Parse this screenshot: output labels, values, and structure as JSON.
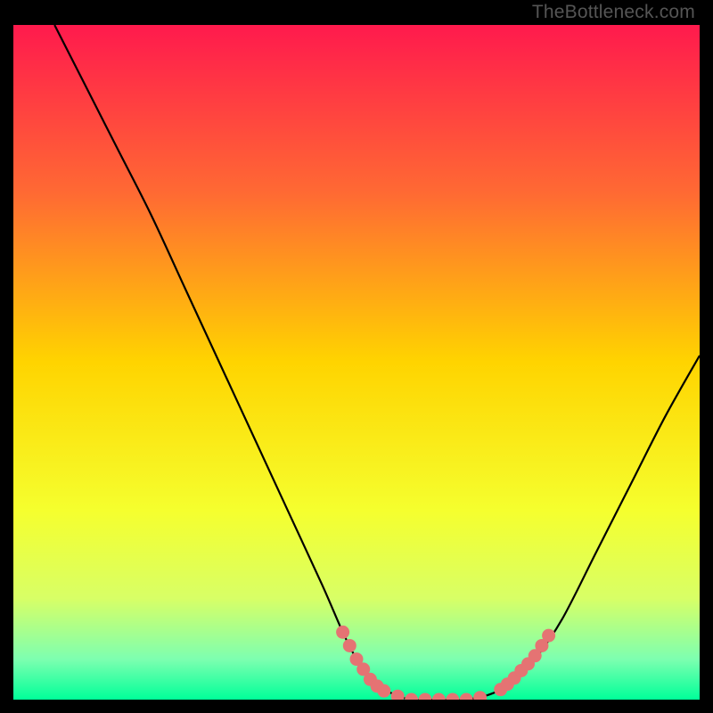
{
  "watermark": "TheBottleneck.com",
  "chart_data": {
    "type": "line",
    "title": "",
    "xlabel": "",
    "ylabel": "",
    "xlim": [
      0,
      100
    ],
    "ylim": [
      0,
      100
    ],
    "background_gradient": {
      "stops": [
        {
          "offset": 0.0,
          "color": "#ff1a4d"
        },
        {
          "offset": 0.25,
          "color": "#ff6a33"
        },
        {
          "offset": 0.5,
          "color": "#ffd400"
        },
        {
          "offset": 0.72,
          "color": "#f5ff2e"
        },
        {
          "offset": 0.85,
          "color": "#d8ff66"
        },
        {
          "offset": 0.94,
          "color": "#7dffb0"
        },
        {
          "offset": 1.0,
          "color": "#00ff99"
        }
      ]
    },
    "series": [
      {
        "name": "bottleneck-curve",
        "color": "#000000",
        "points": [
          {
            "x": 6,
            "y": 100
          },
          {
            "x": 10,
            "y": 92
          },
          {
            "x": 15,
            "y": 82
          },
          {
            "x": 20,
            "y": 72
          },
          {
            "x": 25,
            "y": 61
          },
          {
            "x": 30,
            "y": 50
          },
          {
            "x": 35,
            "y": 39
          },
          {
            "x": 40,
            "y": 28
          },
          {
            "x": 45,
            "y": 17
          },
          {
            "x": 48,
            "y": 10
          },
          {
            "x": 50,
            "y": 6
          },
          {
            "x": 52,
            "y": 3
          },
          {
            "x": 55,
            "y": 1
          },
          {
            "x": 58,
            "y": 0
          },
          {
            "x": 62,
            "y": 0
          },
          {
            "x": 66,
            "y": 0
          },
          {
            "x": 70,
            "y": 1
          },
          {
            "x": 73,
            "y": 3
          },
          {
            "x": 76,
            "y": 6
          },
          {
            "x": 80,
            "y": 12
          },
          {
            "x": 85,
            "y": 22
          },
          {
            "x": 90,
            "y": 32
          },
          {
            "x": 95,
            "y": 42
          },
          {
            "x": 100,
            "y": 51
          }
        ]
      }
    ],
    "dot_clusters": [
      {
        "name": "left-cluster",
        "color": "#e57373",
        "points": [
          {
            "x": 48,
            "y": 10
          },
          {
            "x": 49,
            "y": 8
          },
          {
            "x": 50,
            "y": 6
          },
          {
            "x": 51,
            "y": 4.5
          },
          {
            "x": 52,
            "y": 3
          },
          {
            "x": 53,
            "y": 2
          },
          {
            "x": 54,
            "y": 1.3
          }
        ]
      },
      {
        "name": "bottom-cluster",
        "color": "#e57373",
        "points": [
          {
            "x": 56,
            "y": 0.5
          },
          {
            "x": 58,
            "y": 0
          },
          {
            "x": 60,
            "y": 0
          },
          {
            "x": 62,
            "y": 0
          },
          {
            "x": 64,
            "y": 0
          },
          {
            "x": 66,
            "y": 0
          },
          {
            "x": 68,
            "y": 0.3
          }
        ]
      },
      {
        "name": "right-cluster",
        "color": "#e57373",
        "points": [
          {
            "x": 71,
            "y": 1.5
          },
          {
            "x": 72,
            "y": 2.3
          },
          {
            "x": 73,
            "y": 3.2
          },
          {
            "x": 74,
            "y": 4.3
          },
          {
            "x": 75,
            "y": 5.3
          },
          {
            "x": 76,
            "y": 6.5
          },
          {
            "x": 77,
            "y": 8
          },
          {
            "x": 78,
            "y": 9.5
          }
        ]
      }
    ]
  }
}
